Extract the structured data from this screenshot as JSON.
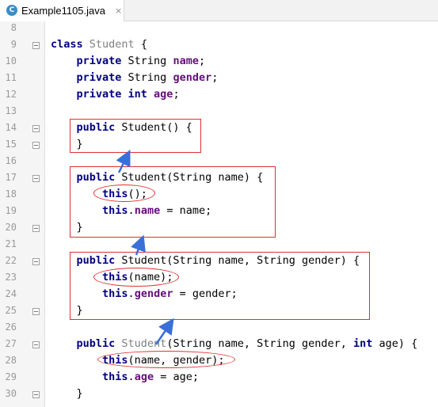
{
  "tab": {
    "label": "Example1105.java",
    "icon": "C",
    "close": "×"
  },
  "colors": {
    "keyword": "#000080",
    "field": "#660e7a",
    "annotation": "#e03030",
    "arrow": "#3a6fd8"
  },
  "lines": [
    {
      "n": "8",
      "segs": []
    },
    {
      "n": "9",
      "segs": [
        {
          "t": "class ",
          "c": "kw"
        },
        {
          "t": "Student",
          "c": "unused"
        },
        {
          "t": " {",
          "c": ""
        }
      ]
    },
    {
      "n": "10",
      "segs": [
        {
          "t": "    private ",
          "c": "kw"
        },
        {
          "t": "String ",
          "c": ""
        },
        {
          "t": "name",
          "c": "fld"
        },
        {
          "t": ";",
          "c": ""
        }
      ]
    },
    {
      "n": "11",
      "segs": [
        {
          "t": "    private ",
          "c": "kw"
        },
        {
          "t": "String ",
          "c": ""
        },
        {
          "t": "gender",
          "c": "fld"
        },
        {
          "t": ";",
          "c": ""
        }
      ]
    },
    {
      "n": "12",
      "segs": [
        {
          "t": "    private int ",
          "c": "kw"
        },
        {
          "t": "age",
          "c": "fld"
        },
        {
          "t": ";",
          "c": ""
        }
      ]
    },
    {
      "n": "13",
      "segs": []
    },
    {
      "n": "14",
      "segs": [
        {
          "t": "    public ",
          "c": "kw"
        },
        {
          "t": "Student() {",
          "c": ""
        }
      ]
    },
    {
      "n": "15",
      "segs": [
        {
          "t": "    }",
          "c": ""
        }
      ]
    },
    {
      "n": "16",
      "segs": []
    },
    {
      "n": "17",
      "segs": [
        {
          "t": "    public ",
          "c": "kw"
        },
        {
          "t": "Student(String name) {",
          "c": ""
        }
      ]
    },
    {
      "n": "18",
      "segs": [
        {
          "t": "        this",
          "c": "kw"
        },
        {
          "t": "();",
          "c": ""
        }
      ]
    },
    {
      "n": "19",
      "segs": [
        {
          "t": "        this",
          "c": "kw"
        },
        {
          "t": ".",
          "c": ""
        },
        {
          "t": "name",
          "c": "fld"
        },
        {
          "t": " = name;",
          "c": ""
        }
      ]
    },
    {
      "n": "20",
      "segs": [
        {
          "t": "    }",
          "c": ""
        }
      ]
    },
    {
      "n": "21",
      "segs": []
    },
    {
      "n": "22",
      "segs": [
        {
          "t": "    public ",
          "c": "kw"
        },
        {
          "t": "Student(String name, String gender) {",
          "c": ""
        }
      ]
    },
    {
      "n": "23",
      "segs": [
        {
          "t": "        this",
          "c": "kw"
        },
        {
          "t": "(name);",
          "c": ""
        }
      ]
    },
    {
      "n": "24",
      "segs": [
        {
          "t": "        this",
          "c": "kw"
        },
        {
          "t": ".",
          "c": ""
        },
        {
          "t": "gender",
          "c": "fld"
        },
        {
          "t": " = gender;",
          "c": ""
        }
      ]
    },
    {
      "n": "25",
      "segs": [
        {
          "t": "    }",
          "c": ""
        }
      ]
    },
    {
      "n": "26",
      "segs": []
    },
    {
      "n": "27",
      "segs": [
        {
          "t": "    public ",
          "c": "kw"
        },
        {
          "t": "Student",
          "c": "unused"
        },
        {
          "t": "(String name, String gender, ",
          "c": ""
        },
        {
          "t": "int ",
          "c": "kw"
        },
        {
          "t": "age) {",
          "c": ""
        }
      ]
    },
    {
      "n": "28",
      "segs": [
        {
          "t": "        this",
          "c": "kw"
        },
        {
          "t": "(name, gender);",
          "c": ""
        }
      ]
    },
    {
      "n": "29",
      "segs": [
        {
          "t": "        this",
          "c": "kw"
        },
        {
          "t": ".",
          "c": ""
        },
        {
          "t": "age",
          "c": "fld"
        },
        {
          "t": " = age;",
          "c": ""
        }
      ]
    },
    {
      "n": "30",
      "segs": [
        {
          "t": "    }",
          "c": ""
        }
      ]
    }
  ]
}
